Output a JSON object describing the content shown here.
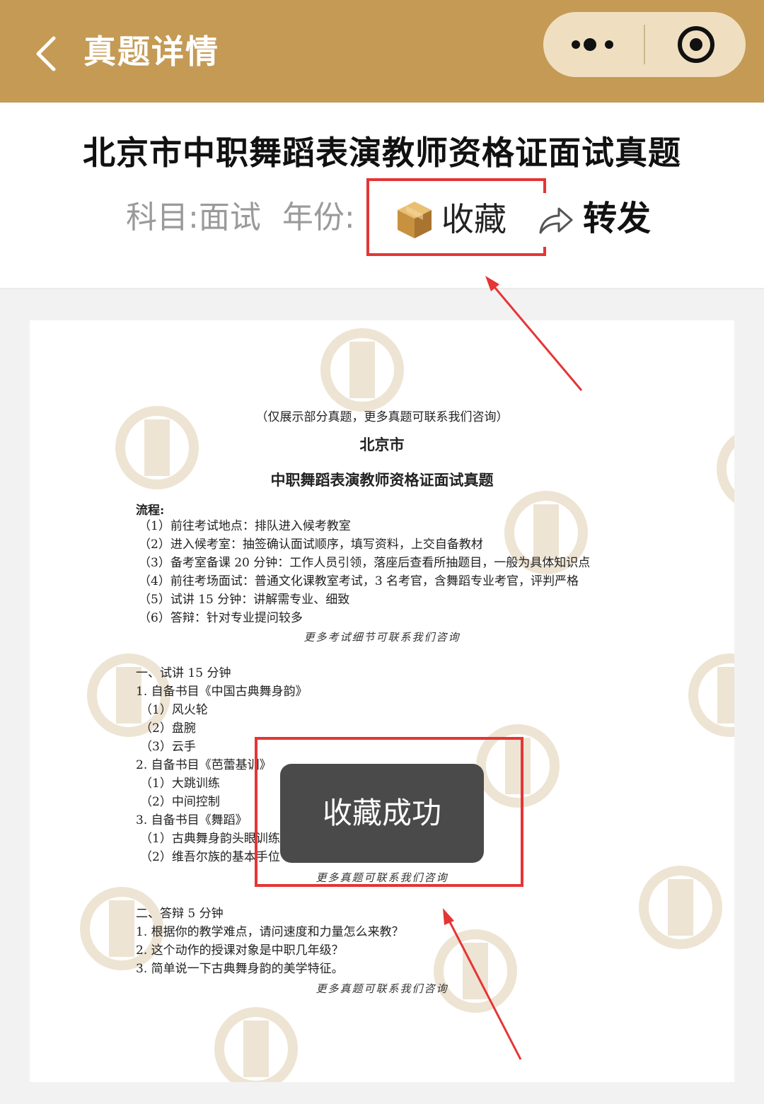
{
  "navbar": {
    "title": "真题详情"
  },
  "header": {
    "title": "北京市中职舞蹈表演教师资格证面试真题",
    "subject": "科目:面试",
    "year_label": "年份:",
    "collect_label": "收藏",
    "share_label": "转发"
  },
  "document": {
    "note_top": "（仅展示部分真题，更多真题可联系我们咨询）",
    "city": "北京市",
    "heading": "中职舞蹈表演教师资格证面试真题",
    "process_label": "流程:",
    "process": [
      "（1）前往考试地点：排队进入候考教室",
      "（2）进入候考室：抽签确认面试顺序，填写资料，上交自备教材",
      "（3）备考室备课 20 分钟：工作人员引领，落座后查看所抽题目，一般为具体知识点",
      "（4）前往考场面试：普通文化课教室考试，3 名考官，含舞蹈专业考官，评判严格",
      "（5）试讲 15 分钟：讲解需专业、细致",
      "（6）答辩：针对专业提问较多"
    ],
    "process_note": "更多考试细节可联系我们咨询",
    "section1_title": "一、试讲 15 分钟",
    "section1_lines": [
      "1. 自备书目《中国古典舞身韵》",
      "（1）风火轮",
      "（2）盘腕",
      "（3）云手",
      "2. 自备书目《芭蕾基训》",
      "（1）大跳训练",
      "（2）中间控制",
      "3. 自备书目《舞蹈》",
      "（1）古典舞身韵头眼训练",
      "（2）维吾尔族的基本手位"
    ],
    "section1_note": "更多真题可联系我们咨询",
    "section2_title": "二、答辩 5 分钟",
    "section2_lines": [
      "1. 根据你的教学难点，请问速度和力量怎么来教？",
      "2. 这个动作的授课对象是中职几年级？",
      "3. 简单说一下古典舞身韵的美学特征。"
    ],
    "section2_note": "更多真题可联系我们咨询"
  },
  "toast": {
    "text": "收藏成功"
  },
  "colors": {
    "brand": "#c49a55",
    "highlight": "#e53535",
    "toast_bg": "#4a4a4a"
  }
}
